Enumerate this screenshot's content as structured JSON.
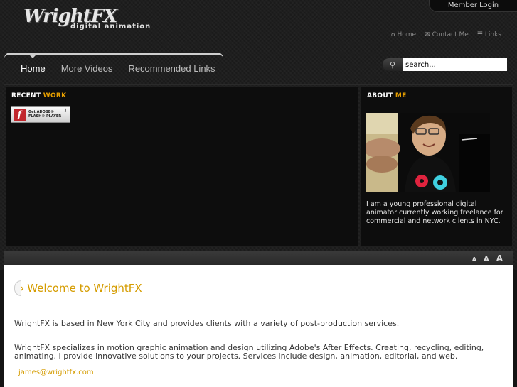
{
  "header": {
    "member_login": "Member Login",
    "logo_main": "WrightFX",
    "logo_sub": "digital animation",
    "top_links": [
      {
        "label": "Home",
        "icon": "home-icon"
      },
      {
        "label": "Contact Me",
        "icon": "mail-icon"
      },
      {
        "label": "Links",
        "icon": "links-icon"
      }
    ]
  },
  "nav": {
    "items": [
      {
        "label": "Home",
        "active": true
      },
      {
        "label": "More Videos",
        "active": false
      },
      {
        "label": "Recommended Links",
        "active": false
      }
    ]
  },
  "search": {
    "value": "search..."
  },
  "recent": {
    "title_a": "RECENT",
    "title_b": "WORK",
    "flash_line1": "Get ADOBE®",
    "flash_line2": "FLASH® PLAYER"
  },
  "about": {
    "title_a": "ABOUT",
    "title_b": "ME",
    "text": "I am a young professional digital animator currently working freelance for commercial and network clients in NYC."
  },
  "font_sizes": [
    "A",
    "A",
    "A"
  ],
  "content": {
    "welcome": "Welcome to WrightFX",
    "para1": "WrightFX is based in New York City and provides clients with a variety of post-production services.",
    "para2": "WrightFX specializes in motion graphic animation and design utilizing Adobe's After Effects.  Creating, recycling, editing, animating.  I provide innovative solutions to your projects.  Services include design, animation, editorial, and web.",
    "email": "james@wrightfx.com"
  },
  "colors": {
    "accent": "#d59c00",
    "accent_title": "#e8a000"
  }
}
